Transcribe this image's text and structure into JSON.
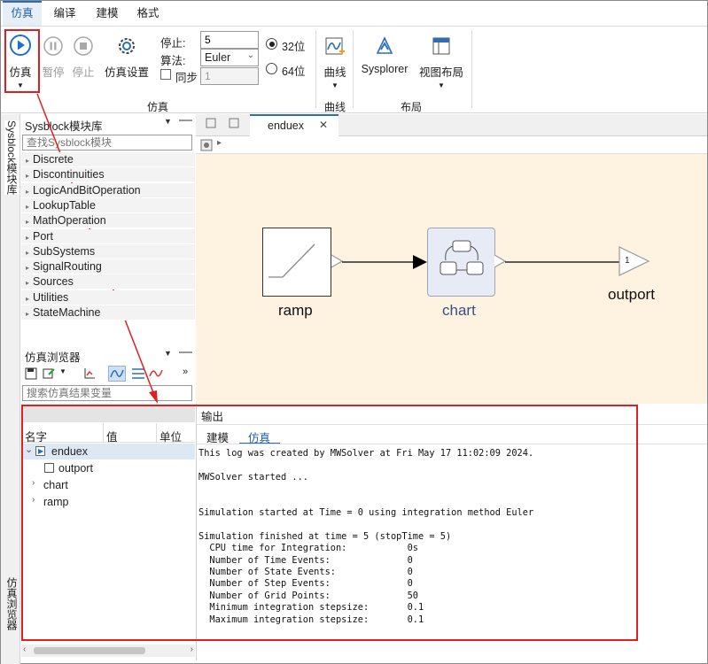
{
  "menu": {
    "tabs": [
      "仿真",
      "编译",
      "建模",
      "格式"
    ]
  },
  "ribbon": {
    "simulate": "仿真",
    "pause": "暂停",
    "stop": "停止",
    "sim_settings": "仿真设置",
    "stop_label": "停止:",
    "stop_value": "5",
    "algo_label": "算法:",
    "algo_value": "Euler",
    "sync_label": "同步",
    "sync_value": "1",
    "bit32": "32位",
    "bit64": "64位",
    "group_sim": "仿真",
    "curve": "曲线",
    "group_curve": "曲线",
    "sysplorer": "Sysplorer",
    "view_layout": "视图布局",
    "group_layout": "布局"
  },
  "library": {
    "side_tab": "Sysblock模块库",
    "title": "Sysblock模块库",
    "search_placeholder": "查找Sysblock模块",
    "items": [
      "Discrete",
      "Discontinuities",
      "LogicAndBitOperation",
      "LookupTable",
      "MathOperation",
      "Port",
      "SubSystems",
      "SignalRouting",
      "Sources",
      "Utilities",
      "StateMachine"
    ]
  },
  "browser": {
    "side_tab": "仿真浏览器",
    "title": "仿真浏览器",
    "search_placeholder": "搜索仿真结果变量",
    "col_name": "名字",
    "col_value": "值",
    "col_unit": "单位",
    "tree": [
      "enduex",
      "outport",
      "chart",
      "ramp"
    ]
  },
  "editor": {
    "tab": "enduex",
    "blocks": {
      "ramp": "ramp",
      "chart": "chart",
      "outport": "outport",
      "outport_num": "1"
    }
  },
  "output": {
    "title": "输出",
    "tabs": [
      "建模",
      "仿真"
    ],
    "log": "This log was created by MWSolver at Fri May 17 11:02:09 2024.\n\nMWSolver started ...\n\n\nSimulation started at Time = 0 using integration method Euler\n\nSimulation finished at time = 5 (stopTime = 5)\n  CPU time for Integration:           0s\n  Number of Time Events:              0\n  Number of State Events:             0\n  Number of Step Events:              0\n  Number of Grid Points:              50\n  Minimum integration stepsize:       0.1\n  Maximum integration stepsize:       0.1"
  },
  "colors": {
    "accent": "#2c6db5",
    "highlight": "#e02020",
    "canvas": "#fdf3e0"
  }
}
